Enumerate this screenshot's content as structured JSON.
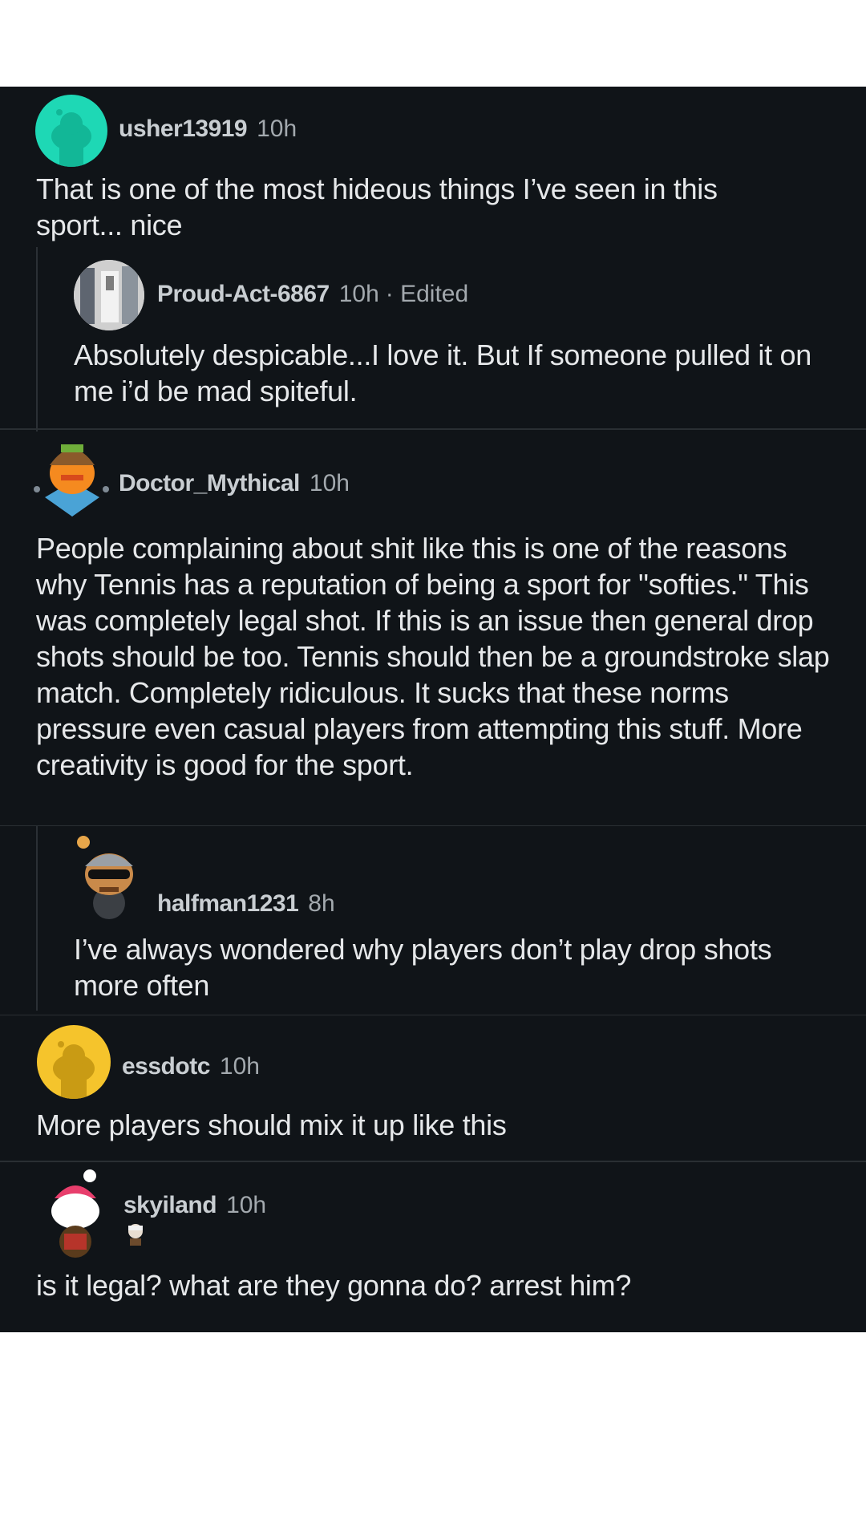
{
  "comments": [
    {
      "username": "usher13919",
      "time": "10h",
      "body": "That is one of the most hideous things I’ve seen in this sport... nice",
      "avatar": "snoo-avatar-teal"
    },
    {
      "username": "Proud-Act-6867",
      "time": "10h",
      "edited": "· Edited",
      "body": "Absolutely despicable...I love it. But If someone pulled it on me i’d be mad spiteful.",
      "avatar": "photo-avatar"
    },
    {
      "username": "Doctor_Mythical",
      "time": "10h",
      "body": "People complaining about shit like this is one of the reasons why Tennis has a reputation of being a sport for \"softies.\" This was completely legal shot. If this is an issue then general drop shots should be too. Tennis should then be a groundstroke slap match. Completely ridiculous. It sucks that these norms pressure even casual players from attempting this stuff. More creativity is good for the sport.",
      "avatar": "snoo-avatar-orange"
    },
    {
      "username": "halfman1231",
      "time": "8h",
      "body": "I’ve always wondered why players don’t play drop shots more often",
      "avatar": "snoo-avatar-sunglasses"
    },
    {
      "username": "essdotc",
      "time": "10h",
      "body": "More players should mix it up like this",
      "avatar": "snoo-avatar-yellow"
    },
    {
      "username": "skyiland",
      "time": "10h",
      "body": "is it legal? what are they gonna do? arrest him?",
      "avatar": "snoo-avatar-santa"
    }
  ],
  "colors": {
    "background": "#101418",
    "username": "#c9ced2",
    "meta": "#a3a9ae",
    "body": "#e6e8ea",
    "divider": "#2a2f33",
    "teal": "#1ed8b5",
    "yellow": "#f5c42c"
  }
}
